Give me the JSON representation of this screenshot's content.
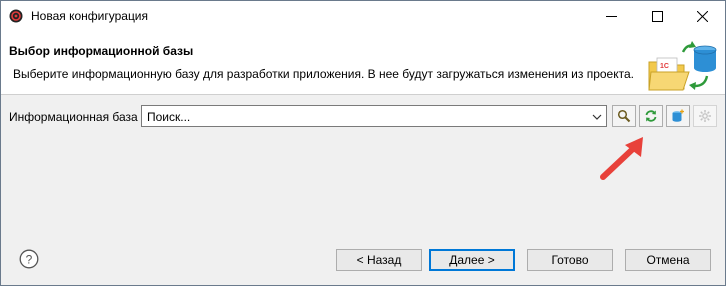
{
  "window": {
    "title": "Новая конфигурация"
  },
  "header": {
    "title": "Выбор информационной базы",
    "description": "Выберите информационную базу для разработки приложения. В нее будут загружаться изменения из проекта."
  },
  "field": {
    "label": "Информационная база",
    "value": "Поиск..."
  },
  "toolbar": {
    "icons": [
      "search-icon",
      "refresh-icon",
      "add-database-icon",
      "settings-icon"
    ],
    "arrow_color": "#e8413a"
  },
  "buttons": {
    "back": "< Назад",
    "next": "Далее >",
    "finish": "Готово",
    "cancel": "Отмена"
  },
  "colors": {
    "accent": "#0078d7",
    "refresh_green": "#2e9a3a",
    "database_blue": "#2d8fd5"
  }
}
